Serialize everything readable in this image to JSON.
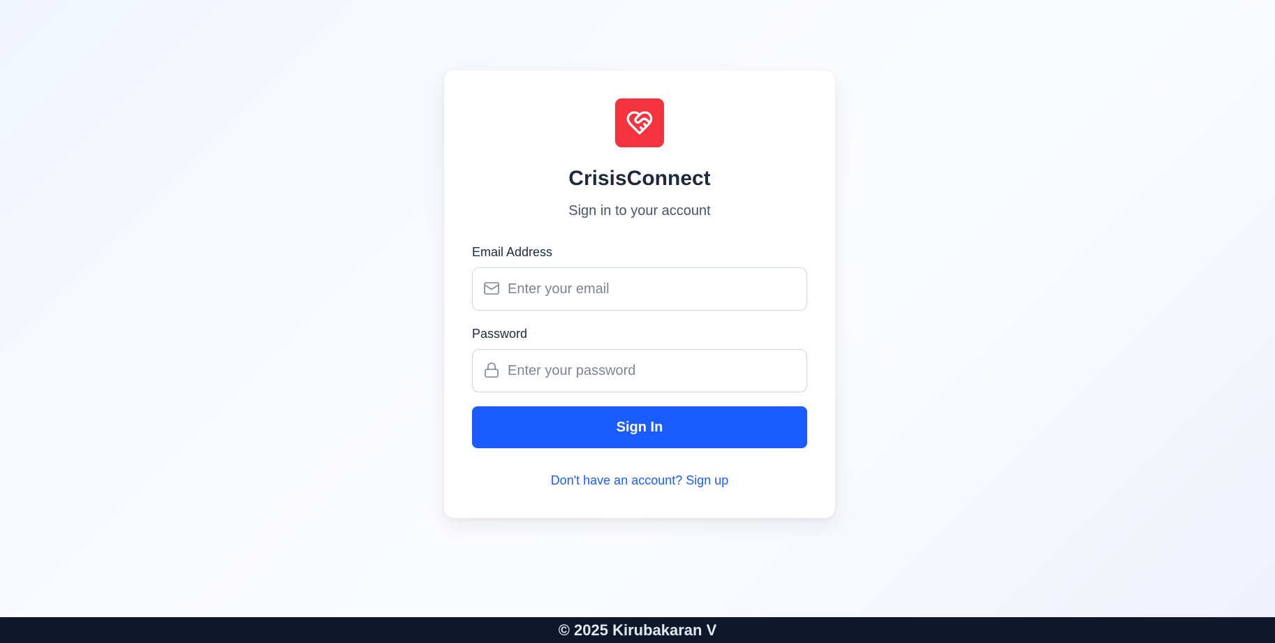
{
  "brand": {
    "name": "CrisisConnect",
    "logo_icon": "heart-handshake-icon",
    "logo_color": "#f5333f"
  },
  "login": {
    "subtitle": "Sign in to your account",
    "email": {
      "label": "Email Address",
      "placeholder": "Enter your email",
      "value": "",
      "icon": "mail-icon"
    },
    "password": {
      "label": "Password",
      "placeholder": "Enter your password",
      "value": "",
      "icon": "lock-icon"
    },
    "submit_label": "Sign In",
    "signup_link": "Don't have an account? Sign up"
  },
  "footer": {
    "text": "© 2025 Kirubakaran V"
  },
  "colors": {
    "primary": "#1a5cff",
    "heading": "#1e293b",
    "footer_bg": "#0f172a"
  }
}
